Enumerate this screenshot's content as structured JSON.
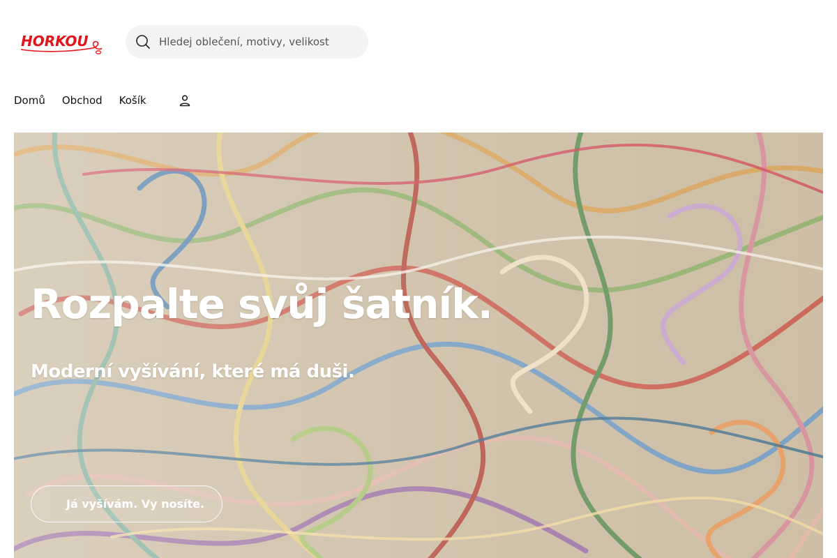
{
  "header": {
    "logo_text": "HORKOU",
    "search": {
      "placeholder": "Hledej oblečení, motivy, velikost",
      "value": ""
    }
  },
  "nav": {
    "items": [
      {
        "label": "Domů"
      },
      {
        "label": "Obchod"
      },
      {
        "label": "Košík"
      }
    ]
  },
  "hero": {
    "title": "Rozpalte svůj šatník.",
    "subtitle": "Moderní vyšívání, které má duši.",
    "cta_label": "Já vyšívám. Vy nosíte."
  },
  "colors": {
    "brand_red": "#e3141b",
    "search_bg": "#f3f3f3",
    "hero_text": "#ffffff"
  },
  "icons": {
    "search": "search-icon",
    "account": "user-icon"
  }
}
